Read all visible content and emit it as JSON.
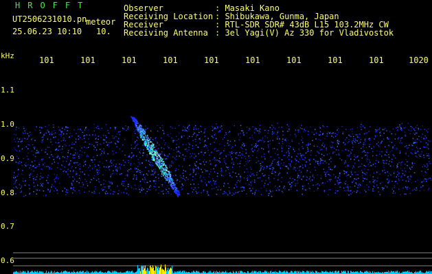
{
  "brand": "HROFFT",
  "file": {
    "name": "UT2506231010.pn",
    "tag": "meteor",
    "datetime": "25.06.23 10:10",
    "count": "10."
  },
  "info": {
    "rows": [
      {
        "label": "Observer",
        "value": ": Masaki Kano"
      },
      {
        "label": "Receiving Location",
        "value": ": Shibukawa, Gunma, Japan"
      },
      {
        "label": "Receiver",
        "value": ": RTL-SDR SDR# 43dB L15 103.2MHz CW"
      },
      {
        "label": "Receiving Antenna",
        "value": ": 3el Yagi(V) Az 330 for Vladivostok"
      }
    ]
  },
  "x_axis": {
    "ticks": [
      "101",
      "101",
      "101",
      "101",
      "101",
      "101",
      "101",
      "101",
      "101",
      "1020"
    ]
  },
  "y_axis": {
    "unit": "kHz",
    "ticks": [
      "1.1",
      "1.0",
      "0.9",
      "0.8",
      "0.7",
      "0.6"
    ]
  },
  "colors": {
    "text": "#ffff66",
    "brand": "#44ee44",
    "noise": "#1a2cff",
    "echo": "#00ffcc",
    "grid": "#888888"
  }
}
